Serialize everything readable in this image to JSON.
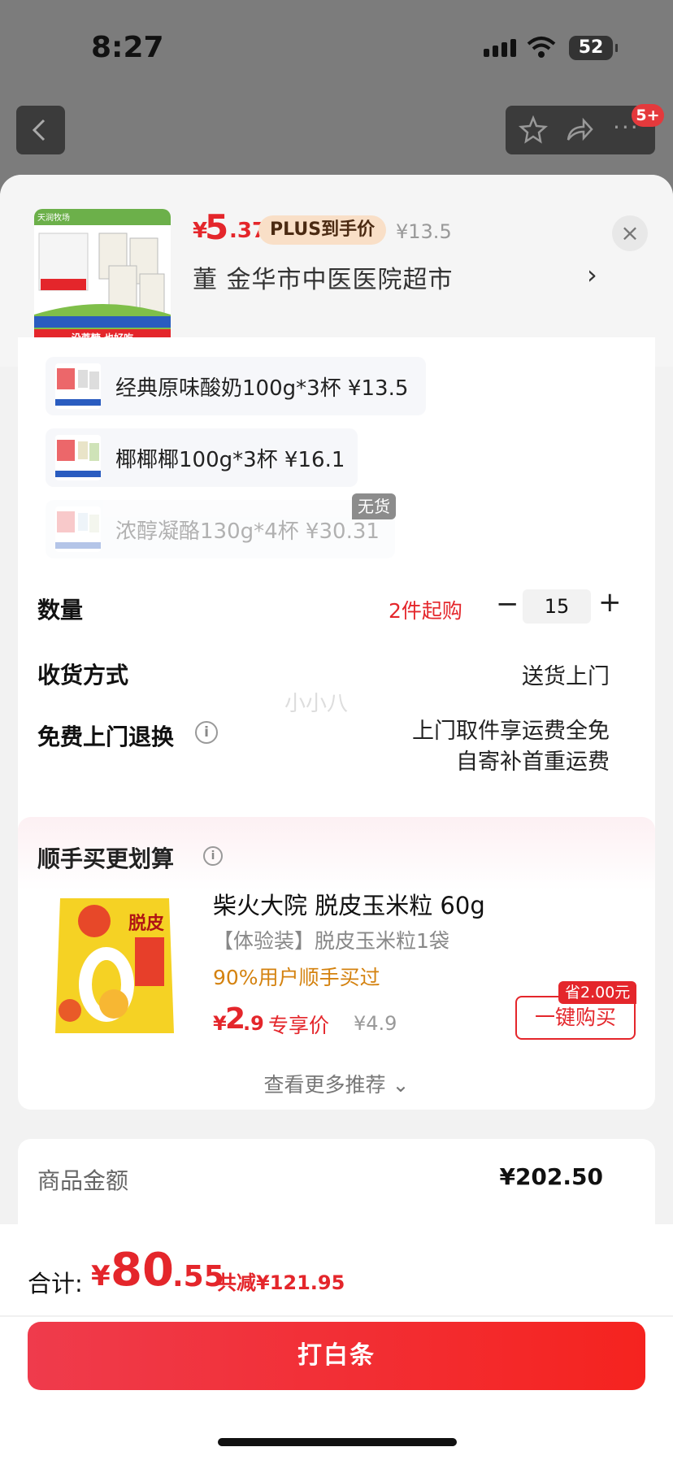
{
  "status_bar": {
    "time": "8:27",
    "battery": "52"
  },
  "nav": {
    "cart_badge": "5+"
  },
  "product": {
    "price_symbol": "¥",
    "price_int": "5",
    "price_dec": ".37",
    "plus_label": "PLUS到手价",
    "original_price": "¥13.5",
    "address": "董  金华市中医医院超市",
    "thumb_brand": "天润牧场",
    "thumb_banner": "没蔗糖 也好吃"
  },
  "variants": [
    {
      "label": "经典原味酸奶100g*3杯  ¥13.5",
      "available": true
    },
    {
      "label": "椰椰椰100g*3杯  ¥16.1",
      "available": true
    },
    {
      "label": "浓醇凝酪130g*4杯  ¥30.31",
      "available": false
    }
  ],
  "out_of_stock_label": "无货",
  "quantity": {
    "label": "数量",
    "min_purchase": "2件起购",
    "value": "15",
    "minus": "−",
    "plus": "+"
  },
  "delivery": {
    "label": "收货方式",
    "value": "送货上门"
  },
  "returns": {
    "label": "免费上门退换",
    "line1": "上门取件享运费全免",
    "line2": "自寄补首重运费"
  },
  "watermark": "小小八",
  "recommend": {
    "title": "顺手买更划算",
    "item": {
      "name": "柴火大院 脱皮玉米粒 60g",
      "sub": "【体验装】脱皮玉米粒1袋",
      "bought": "90%用户顺手买过",
      "price_symbol": "¥",
      "price_int": "2",
      "price_dec": ".9",
      "price_label": "专享价",
      "original_price": "¥4.9",
      "save_badge": "省2.00元",
      "buy_label": "一键购买",
      "thumb_text": "脱皮"
    },
    "more": "查看更多推荐"
  },
  "summary": {
    "label": "商品金额",
    "value": "¥202.50"
  },
  "footer": {
    "total_label": "合计:",
    "total_symbol": "¥",
    "total_int": "80",
    "total_dec": ".55",
    "total_savings": "共减¥121.95",
    "pay_label": "打白条"
  }
}
